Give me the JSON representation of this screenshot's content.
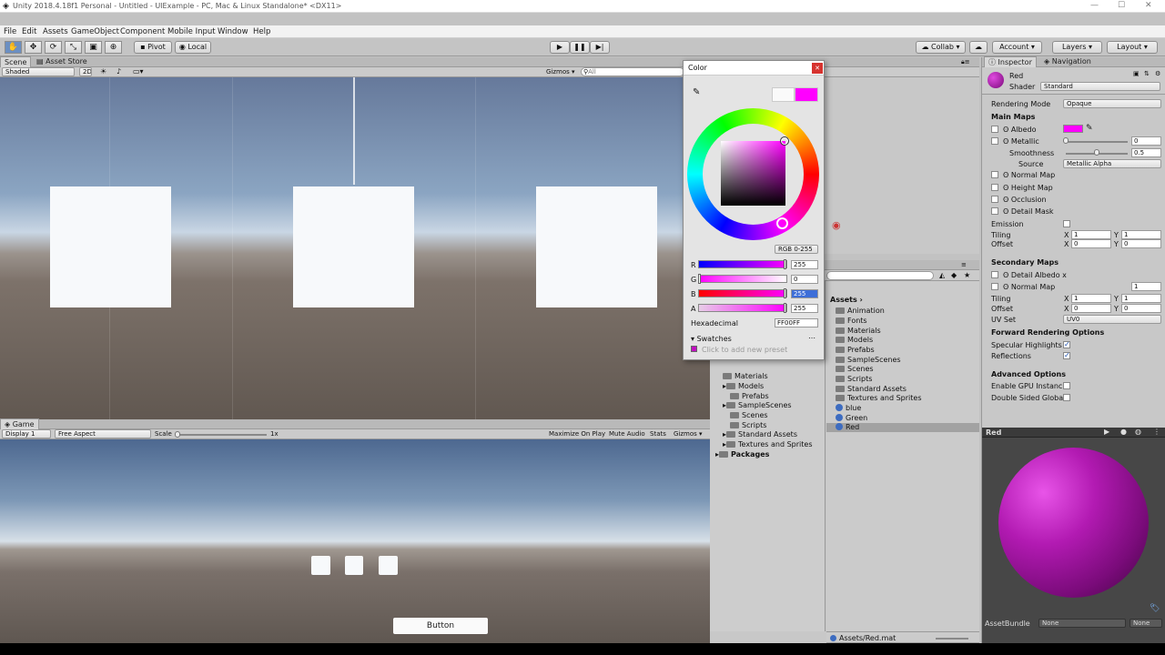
{
  "window": {
    "title": "Unity 2018.4.18f1 Personal - Untitled - UIExample - PC, Mac & Linux Standalone* <DX11>"
  },
  "menu": [
    "File",
    "Edit",
    "Assets",
    "GameObject",
    "Component",
    "Mobile Input",
    "Window",
    "Help"
  ],
  "toolbar": {
    "tools": [
      "hand-icon",
      "move-icon",
      "rotate-icon",
      "scale-icon",
      "rect-icon",
      "transform-icon"
    ],
    "pivot": "Pivot",
    "local": "Local",
    "collab": "Collab",
    "account": "Account",
    "layers": "Layers",
    "layout": "Layout"
  },
  "scene": {
    "tab": "Scene",
    "tab2": "Asset Store",
    "shading": "Shaded",
    "mode2d": "2D",
    "gizmos": "Gizmos",
    "search": "All"
  },
  "game": {
    "tab": "Game",
    "display": "Display 1",
    "aspect": "Free Aspect",
    "scale_label": "Scale",
    "scale_value": "1x",
    "maximize": "Maximize On Play",
    "mute": "Mute Audio",
    "stats": "Stats",
    "gizmos": "Gizmos",
    "button": "Button"
  },
  "color_picker": {
    "title": "Color",
    "mode": "RGB 0-255",
    "channels": [
      {
        "label": "R",
        "value": "255"
      },
      {
        "label": "G",
        "value": "0"
      },
      {
        "label": "B",
        "value": "255"
      },
      {
        "label": "A",
        "value": "255"
      }
    ],
    "hex_label": "Hexadecimal",
    "hex_value": "FF00FF",
    "swatches_label": "Swatches",
    "swatch_hint": "Click to add new preset",
    "current_color": "#ff00ff"
  },
  "project": {
    "breadcrumb": "Assets",
    "assets": [
      {
        "name": "Animation",
        "kind": "folder"
      },
      {
        "name": "Fonts",
        "kind": "folder"
      },
      {
        "name": "Materials",
        "kind": "folder"
      },
      {
        "name": "Models",
        "kind": "folder"
      },
      {
        "name": "Prefabs",
        "kind": "folder"
      },
      {
        "name": "SampleScenes",
        "kind": "folder"
      },
      {
        "name": "Scenes",
        "kind": "folder"
      },
      {
        "name": "Scripts",
        "kind": "folder"
      },
      {
        "name": "Standard Assets",
        "kind": "folder"
      },
      {
        "name": "Textures and Sprites",
        "kind": "folder"
      },
      {
        "name": "blue",
        "kind": "material"
      },
      {
        "name": "Green",
        "kind": "material"
      },
      {
        "name": "Red",
        "kind": "material"
      }
    ],
    "tree": [
      "Materials",
      "Models",
      "Prefabs",
      "SampleScenes",
      "Scenes",
      "Scripts",
      "Standard Assets",
      "Textures and Sprites"
    ],
    "packages": "Packages",
    "footer_path": "Assets/Red.mat"
  },
  "inspector": {
    "tab": "Inspector",
    "tab2": "Navigation",
    "name": "Red",
    "shader_label": "Shader",
    "shader_value": "Standard",
    "rendering_mode_label": "Rendering Mode",
    "rendering_mode_value": "Opaque",
    "main_maps": "Main Maps",
    "albedo": "Albedo",
    "metallic": "Metallic",
    "metallic_value": "0",
    "smoothness": "Smoothness",
    "smoothness_value": "0.5",
    "source": "Source",
    "source_value": "Metallic Alpha",
    "normal_map": "Normal Map",
    "height_map": "Height Map",
    "occlusion": "Occlusion",
    "detail_mask": "Detail Mask",
    "emission": "Emission",
    "tiling": "Tiling",
    "offset": "Offset",
    "x": "X",
    "y": "Y",
    "tiling_x": "1",
    "tiling_y": "1",
    "offset_x": "0",
    "offset_y": "0",
    "secondary_maps": "Secondary Maps",
    "detail_albedo": "Detail Albedo x",
    "normal_map2": "Normal Map",
    "normal_map2_value": "1",
    "uv_set": "UV Set",
    "uv_set_value": "UV0",
    "forward": "Forward Rendering Options",
    "specular": "Specular Highlights",
    "reflections": "Reflections",
    "advanced": "Advanced Options",
    "gpu_instancing": "Enable GPU Instancin",
    "double_sided": "Double Sided Global",
    "preview_title": "Red",
    "assetbundle": "AssetBundle",
    "ab_value1": "None",
    "ab_value2": "None"
  }
}
